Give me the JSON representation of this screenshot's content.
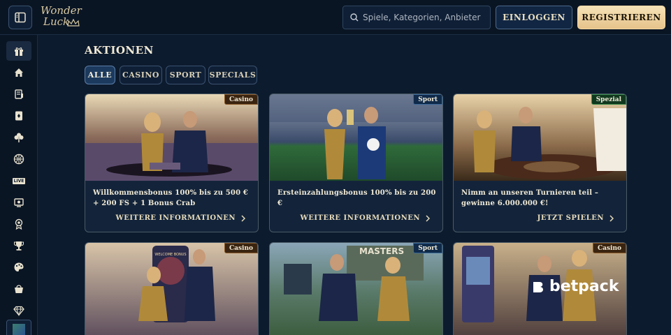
{
  "brand": {
    "logo_line1": "Wonder",
    "logo_line2": "Luck"
  },
  "header": {
    "search_placeholder": "Spiele, Kategorien, Anbieter",
    "login_label": "EINLOGGEN",
    "register_label": "REGISTRIEREN"
  },
  "sidebar": {
    "items": [
      {
        "icon": "gift-icon"
      },
      {
        "icon": "home-icon"
      },
      {
        "icon": "sports-betting-icon"
      },
      {
        "icon": "cards-icon"
      },
      {
        "icon": "clover-icon"
      },
      {
        "icon": "basketball-icon"
      },
      {
        "icon": "live-icon",
        "label": "LIVE"
      },
      {
        "icon": "tv-icon"
      },
      {
        "icon": "medal-icon"
      },
      {
        "icon": "trophy-icon"
      },
      {
        "icon": "palette-icon"
      },
      {
        "icon": "shop-basket-icon"
      },
      {
        "icon": "diamond-icon"
      }
    ]
  },
  "page": {
    "title": "AKTIONEN"
  },
  "filters": [
    {
      "label": "ALLE",
      "active": true
    },
    {
      "label": "CASINO",
      "active": false
    },
    {
      "label": "SPORT",
      "active": false
    },
    {
      "label": "SPECIALS",
      "active": false
    }
  ],
  "cards": [
    {
      "badge": "Casino",
      "badge_type": "casino",
      "text": "Willkommensbonus 100% bis zu 500 € + 200 FS + 1 Bonus Crab",
      "cta": "WEITERE INFORMATIONEN"
    },
    {
      "badge": "Sport",
      "badge_type": "sport",
      "text": "Ersteinzahlungsbonus 100% bis zu 200 €",
      "cta": "WEITERE INFORMATIONEN"
    },
    {
      "badge": "Spezial",
      "badge_type": "spezial",
      "text": "Nimm an unseren Turnieren teil – gewinne 6.000.000 €!",
      "cta": "JETZT SPIELEN"
    },
    {
      "badge": "Casino",
      "badge_type": "casino",
      "text": "",
      "cta": ""
    },
    {
      "badge": "Sport",
      "badge_type": "sport",
      "text": "",
      "cta": ""
    },
    {
      "badge": "Casino",
      "badge_type": "casino",
      "text": "",
      "cta": ""
    }
  ],
  "card_images": [
    {
      "sign": ""
    },
    {
      "sign": ""
    },
    {
      "sign": ""
    },
    {
      "sign": "WELCOME BONUS"
    },
    {
      "sign": "MASTERS"
    },
    {
      "sign": ""
    }
  ],
  "watermark": {
    "text": "betpack"
  },
  "colors": {
    "accent_gold": "#e6c38a",
    "navy": "#0d1b2e",
    "active_filter": "#1c3a5e"
  }
}
